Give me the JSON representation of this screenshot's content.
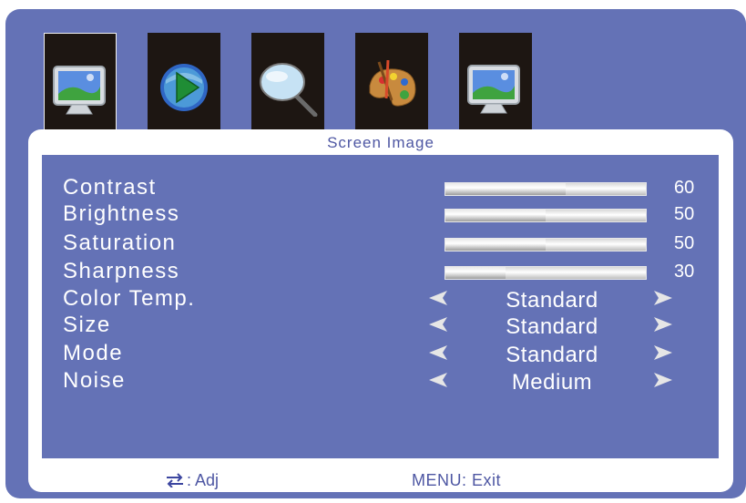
{
  "tabs": [
    {
      "icon": "monitor-icon",
      "selected": true
    },
    {
      "icon": "play-icon",
      "selected": false
    },
    {
      "icon": "magnifier-icon",
      "selected": false
    },
    {
      "icon": "palette-icon",
      "selected": false
    },
    {
      "icon": "monitor-icon",
      "selected": false
    }
  ],
  "panel": {
    "title": "Screen Image"
  },
  "sliders": [
    {
      "label": "Contrast",
      "value": "60",
      "level": 60
    },
    {
      "label": "Brightness",
      "value": "50",
      "level": 50
    },
    {
      "label": "Saturation",
      "value": "50",
      "level": 50
    },
    {
      "label": "Sharpness",
      "value": "30",
      "level": 30
    }
  ],
  "options": [
    {
      "label": "Color Temp.",
      "value": "Standard"
    },
    {
      "label": "Size",
      "value": "Standard"
    },
    {
      "label": "Mode",
      "value": "Standard"
    },
    {
      "label": "Noise",
      "value": "Medium"
    }
  ],
  "footer": {
    "adj_label": ": Adj",
    "exit_label": "MENU: Exit"
  },
  "colors": {
    "background": "#6472b6",
    "panel": "#ffffff",
    "accent_text": "#4e57a3"
  }
}
